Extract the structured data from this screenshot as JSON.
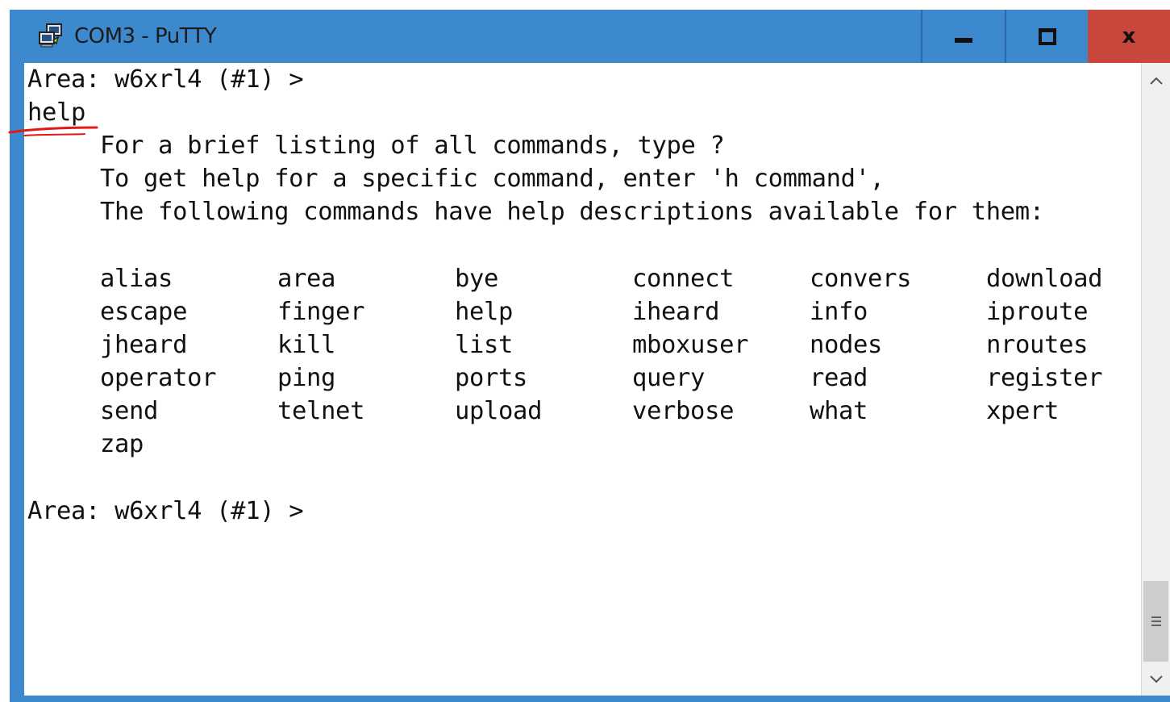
{
  "window": {
    "title": "COM3 - PuTTY",
    "app_icon": "putty-icon",
    "controls": {
      "minimize": "minimize-icon",
      "maximize": "maximize-icon",
      "close": "×"
    },
    "colors": {
      "titlebar": "#3d89ce",
      "close": "#c7473d"
    }
  },
  "terminal": {
    "prompt_1": "Area: w6xrl4 (#1) >",
    "input": "help",
    "help_lines": [
      "For a brief listing of all commands, type ?",
      "To get help for a specific command, enter 'h command',",
      "The following commands have help descriptions available for them:"
    ],
    "commands": [
      [
        "alias",
        "area",
        "bye",
        "connect",
        "convers",
        "download"
      ],
      [
        "escape",
        "finger",
        "help",
        "iheard",
        "info",
        "iproute"
      ],
      [
        "jheard",
        "kill",
        "list",
        "mboxuser",
        "nodes",
        "nroutes"
      ],
      [
        "operator",
        "ping",
        "ports",
        "query",
        "read",
        "register"
      ],
      [
        "send",
        "telnet",
        "upload",
        "verbose",
        "what",
        "xpert"
      ],
      [
        "zap"
      ]
    ],
    "prompt_2": "Area: w6xrl4 (#1) >"
  },
  "scrollbar": {
    "up": "chevron-up-icon",
    "down": "chevron-down-icon"
  }
}
